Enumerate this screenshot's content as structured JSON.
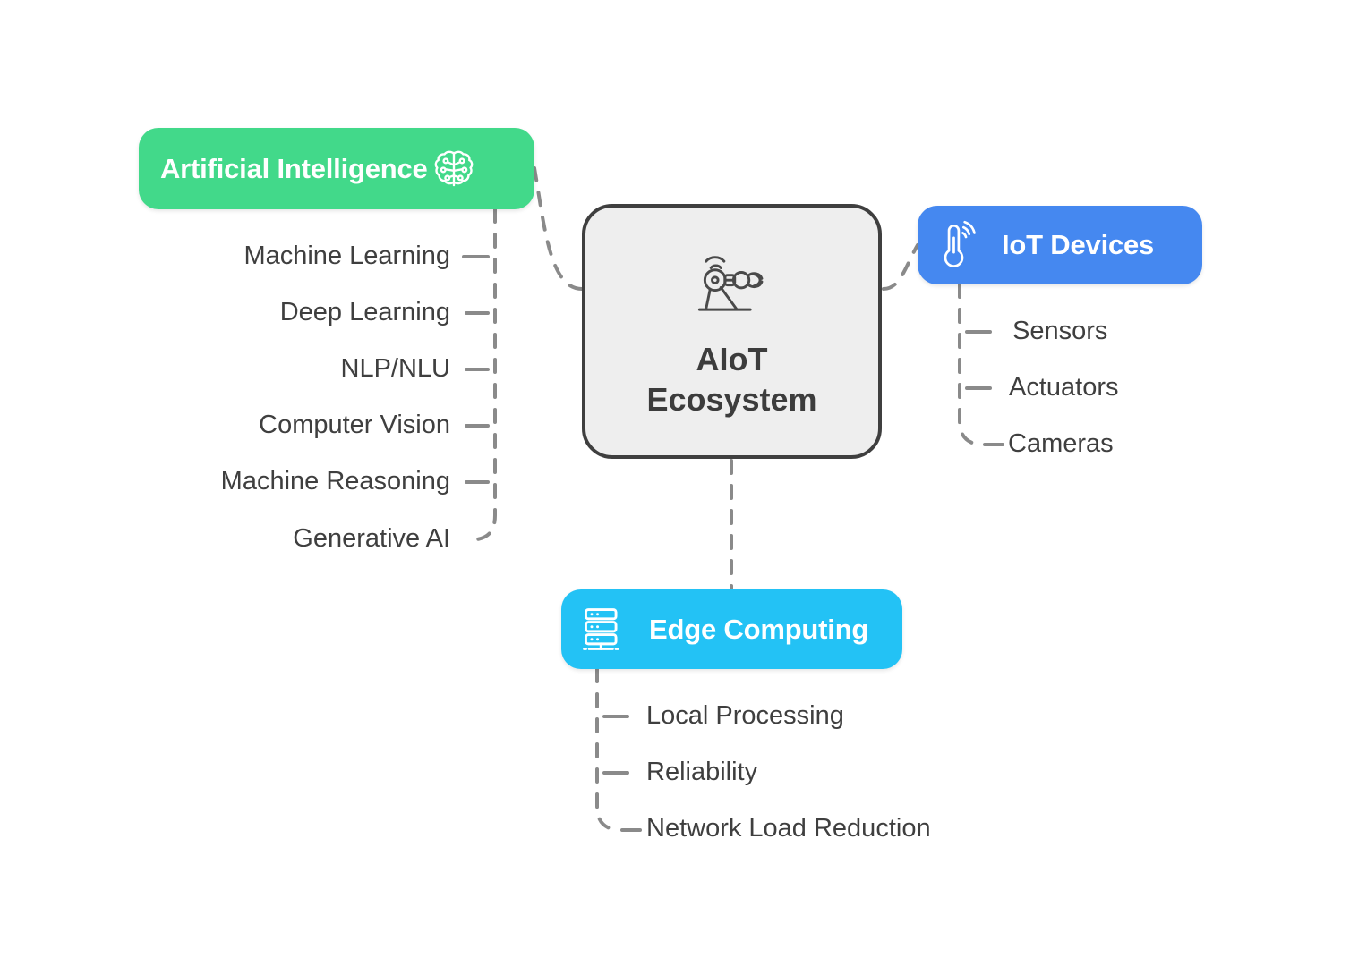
{
  "diagram": {
    "title": "AIoT Ecosystem mind map",
    "center": {
      "title": "AIoT\nEcosystem",
      "icon": "robotic-arm-wireless-icon",
      "fill": "#eeeeee",
      "border": "#3f3f3f",
      "text_color": "#3c3c3c"
    },
    "branches": [
      {
        "id": "ai",
        "label": "Artificial Intelligence",
        "icon": "brain-icon",
        "icon_side": "right",
        "color": "#42d98a",
        "text_color": "#ffffff",
        "side": "left",
        "children": [
          "Machine Learning",
          "Deep Learning",
          "NLP/NLU",
          "Computer Vision",
          "Machine Reasoning",
          "Generative AI"
        ]
      },
      {
        "id": "iot",
        "label": "IoT Devices",
        "icon": "thermometer-wireless-icon",
        "icon_side": "left",
        "color": "#4588f0",
        "text_color": "#ffffff",
        "side": "right",
        "children": [
          "Sensors",
          "Actuators",
          "Cameras"
        ]
      },
      {
        "id": "edge",
        "label": "Edge Computing",
        "icon": "server-rack-icon",
        "icon_side": "left",
        "color": "#23c2f5",
        "text_color": "#ffffff",
        "side": "bottom",
        "children": [
          "Local Processing",
          "Reliability",
          "Network Load Reduction"
        ]
      }
    ],
    "connector": {
      "style": "dashed",
      "color": "#8a8a8a",
      "width": 4
    },
    "background": "#ffffff"
  }
}
